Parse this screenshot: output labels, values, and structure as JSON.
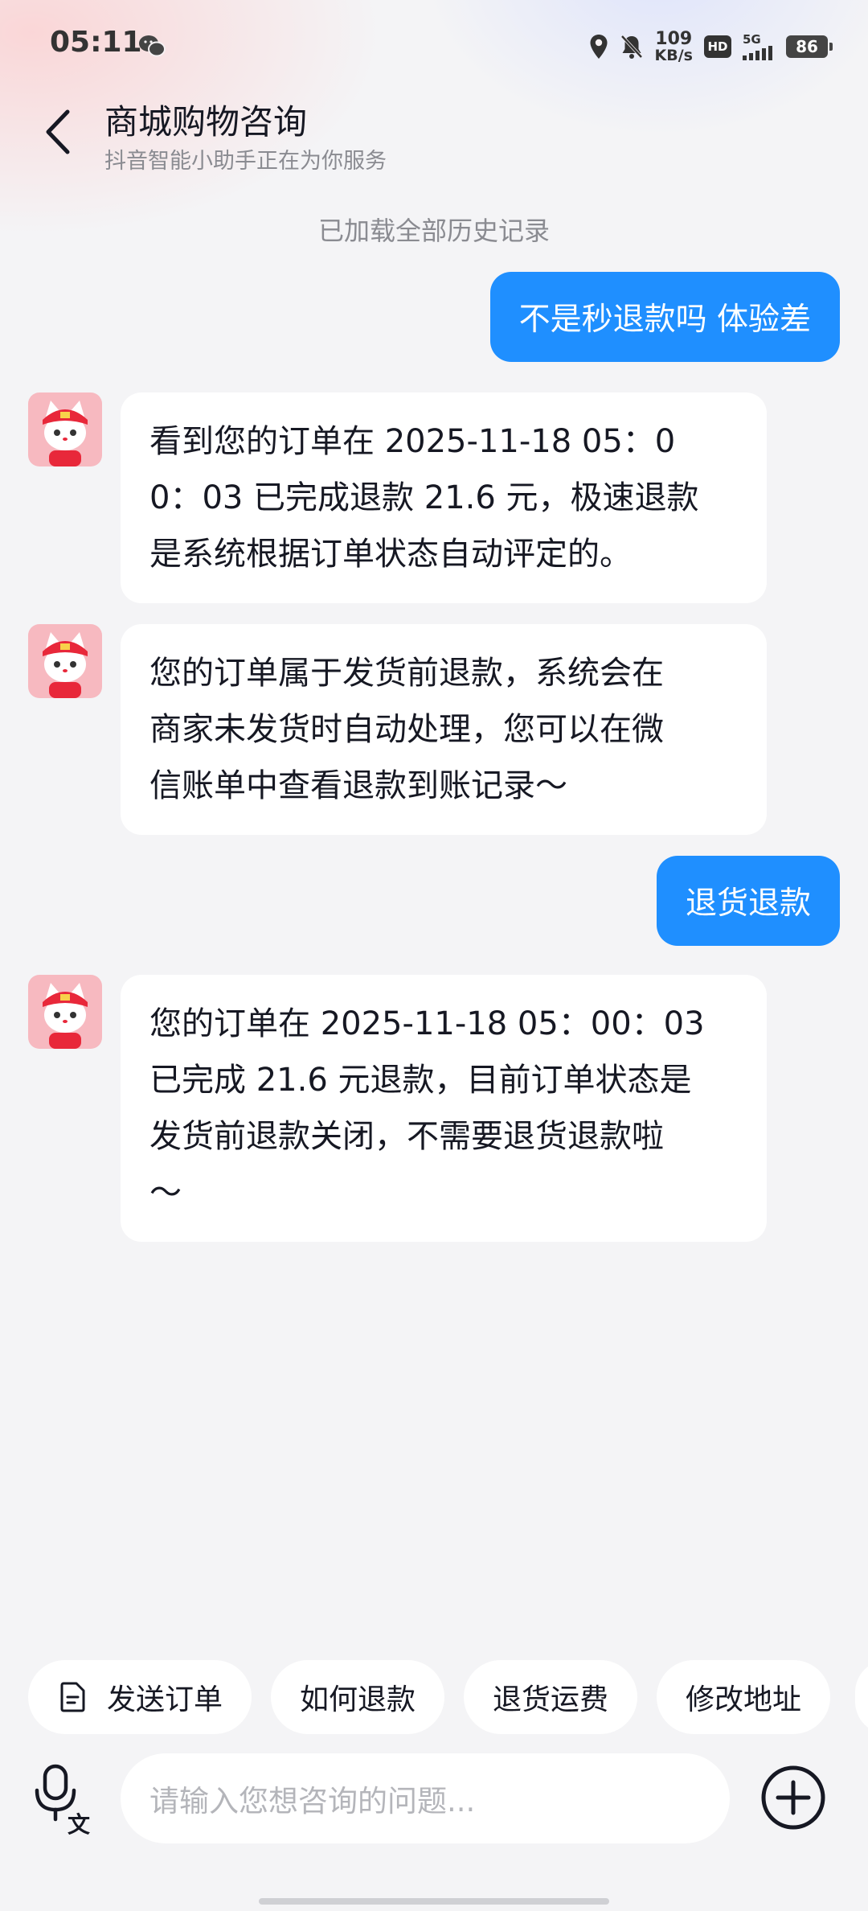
{
  "status_bar": {
    "time": "05:11",
    "net_speed_value": "109",
    "net_speed_unit": "KB/s",
    "hd_badge": "HD",
    "network_type": "5G",
    "battery": "86"
  },
  "header": {
    "title": "商城购物咨询",
    "subtitle": "抖音智能小助手正在为你服务"
  },
  "history_notice": "已加载全部历史记录",
  "messages": [
    {
      "from": "user",
      "text": "不是秒退款吗 体验差"
    },
    {
      "from": "bot",
      "text": "看到您的订单在 2025-11-18 05：0\n0：03 已完成退款 21.6 元，极速退款\n是系统根据订单状态自动评定的。"
    },
    {
      "from": "bot",
      "text": "您的订单属于发货前退款，系统会在\n商家未发货时自动处理，您可以在微\n信账单中查看退款到账记录～"
    },
    {
      "from": "user",
      "text": "退货退款"
    },
    {
      "from": "bot",
      "text": "您的订单在 2025-11-18 05：00：03\n已完成 21.6 元退款，目前订单状态是\n发货前退款关闭，不需要退货退款啦\n～"
    }
  ],
  "quick_replies": [
    {
      "label": "发送订单",
      "icon": "document-icon"
    },
    {
      "label": "如何退款"
    },
    {
      "label": "退货运费"
    },
    {
      "label": "修改地址"
    }
  ],
  "input": {
    "placeholder": "请输入您想咨询的问题..."
  },
  "colors": {
    "user_bubble": "#1f8fff",
    "background": "#f4f4f6"
  }
}
